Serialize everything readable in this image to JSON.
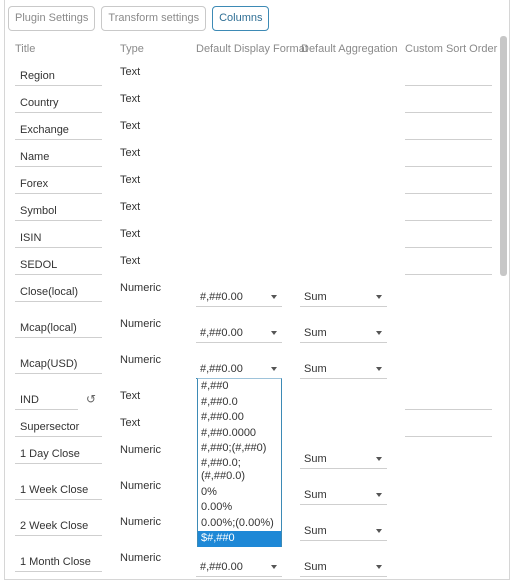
{
  "tabs": [
    {
      "label": "Plugin Settings",
      "active": false
    },
    {
      "label": "Transform settings",
      "active": false
    },
    {
      "label": "Columns",
      "active": true
    }
  ],
  "headers": {
    "title": "Title",
    "type": "Type",
    "format": "Default Display Format",
    "aggregation": "Default Aggregation",
    "sort": "Custom Sort Order"
  },
  "rows": [
    {
      "title": "Region",
      "type": "Text"
    },
    {
      "title": "Country",
      "type": "Text"
    },
    {
      "title": "Exchange",
      "type": "Text"
    },
    {
      "title": "Name",
      "type": "Text"
    },
    {
      "title": "Forex",
      "type": "Text"
    },
    {
      "title": "Symbol",
      "type": "Text"
    },
    {
      "title": "ISIN",
      "type": "Text"
    },
    {
      "title": "SEDOL",
      "type": "Text"
    },
    {
      "title": "Close(local)",
      "type": "Numeric",
      "format": "#,##0.00",
      "aggregation": "Sum"
    },
    {
      "title": "Mcap(local)",
      "type": "Numeric",
      "format": "#,##0.00",
      "aggregation": "Sum"
    },
    {
      "title": "Mcap(USD)",
      "type": "Numeric",
      "format": "#,##0.00",
      "aggregation": "Sum"
    },
    {
      "title": "IND",
      "type": "Text"
    },
    {
      "title": "Supersector",
      "type": "Text"
    },
    {
      "title": "1 Day Close",
      "type": "Numeric",
      "aggregation": "Sum"
    },
    {
      "title": "1 Week Close",
      "type": "Numeric",
      "aggregation": "Sum"
    },
    {
      "title": "2 Week Close",
      "type": "Numeric",
      "aggregation": "Sum"
    },
    {
      "title": "1 Month Close",
      "type": "Numeric",
      "format": "#,##0.00",
      "aggregation": "Sum"
    }
  ],
  "dropdown": {
    "options": [
      "#,##0",
      "#,##0.0",
      "#,##0.00",
      "#,##0.0000",
      "#,##0;(#,##0)",
      "#,##0.0;(#,##0.0)",
      "0%",
      "0.00%",
      "0.00%;(0.00%)",
      "$#,##0"
    ],
    "selected": "$#,##0"
  },
  "icons": {
    "reset": "undo-icon",
    "caret": "chevron-down-icon"
  },
  "colors": {
    "accent": "#3d8ab5",
    "selected": "#1e88d6"
  }
}
